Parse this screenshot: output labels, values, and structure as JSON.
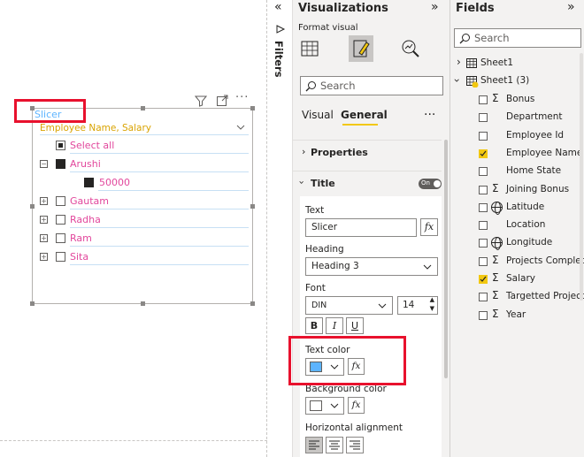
{
  "canvas": {
    "slicer": {
      "title": "Slicer",
      "field_header": "Employee Name, Salary",
      "select_all": "Select all",
      "items": [
        {
          "label": "Arushi",
          "expanded": true,
          "checked": true,
          "child": "50000"
        },
        {
          "label": "Gautam"
        },
        {
          "label": "Radha"
        },
        {
          "label": "Ram"
        },
        {
          "label": "Sita"
        }
      ],
      "title_color": "#5db4ff",
      "item_color": "#e2479c",
      "header_color": "#d9a300"
    }
  },
  "filters_pane": {
    "label": "Filters",
    "collapse_icon": "double-chevron-left-icon"
  },
  "visualizations": {
    "title": "Visualizations",
    "subtitle": "Format visual",
    "search_placeholder": "Search",
    "tabs": [
      "Visual",
      "General"
    ],
    "more": "···",
    "properties_label": "Properties",
    "title_section": {
      "label": "Title",
      "toggle": "On",
      "text_label": "Text",
      "text_value": "Slicer",
      "heading_label": "Heading",
      "heading_value": "Heading 3",
      "font_label": "Font",
      "font_value": "DIN",
      "font_size": "14",
      "bold": "B",
      "italic": "I",
      "underline": "U",
      "text_color_label": "Text color",
      "text_color": "#5db4ff",
      "bg_color_label": "Background color",
      "bg_color": "#ffffff",
      "align_label": "Horizontal alignment",
      "fx": "fx"
    }
  },
  "fields": {
    "title": "Fields",
    "search_placeholder": "Search",
    "tables": [
      {
        "name": "Sheet1"
      },
      {
        "name": "Sheet1 (3)"
      }
    ],
    "items": [
      {
        "name": "Bonus",
        "type": "sigma",
        "checked": false
      },
      {
        "name": "Department",
        "type": "text",
        "checked": false
      },
      {
        "name": "Employee Id",
        "type": "text",
        "checked": false
      },
      {
        "name": "Employee Name",
        "type": "text",
        "checked": true
      },
      {
        "name": "Home State",
        "type": "text",
        "checked": false
      },
      {
        "name": "Joining Bonus",
        "type": "sigma",
        "checked": false
      },
      {
        "name": "Latitude",
        "type": "globe",
        "checked": false
      },
      {
        "name": "Location",
        "type": "text",
        "checked": false
      },
      {
        "name": "Longitude",
        "type": "globe",
        "checked": false
      },
      {
        "name": "Projects Complet...",
        "type": "sigma",
        "checked": false
      },
      {
        "name": "Salary",
        "type": "sigma",
        "checked": true
      },
      {
        "name": "Targetted Projects",
        "type": "sigma",
        "checked": false
      },
      {
        "name": "Year",
        "type": "sigma",
        "checked": false
      }
    ]
  }
}
